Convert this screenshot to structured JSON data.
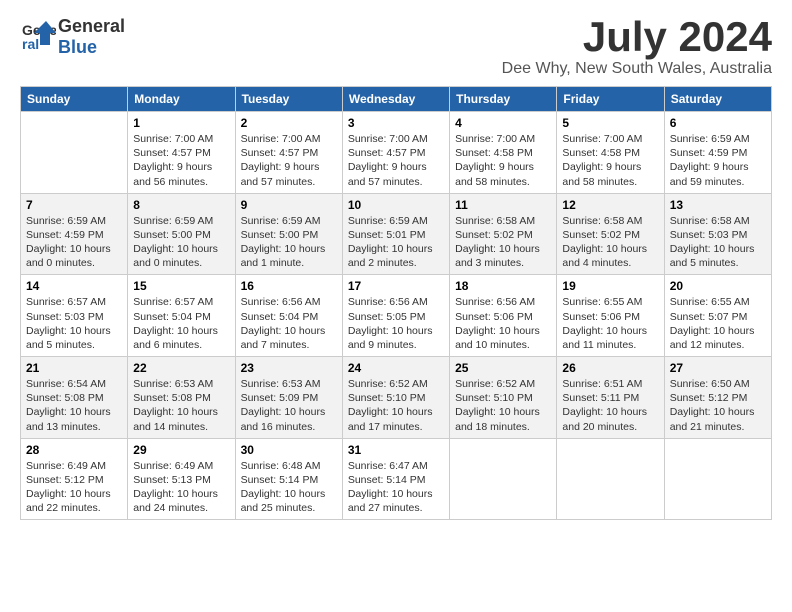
{
  "logo": {
    "general": "General",
    "blue": "Blue"
  },
  "title": "July 2024",
  "subtitle": "Dee Why, New South Wales, Australia",
  "days": [
    "Sunday",
    "Monday",
    "Tuesday",
    "Wednesday",
    "Thursday",
    "Friday",
    "Saturday"
  ],
  "weeks": [
    [
      {
        "date": "",
        "info": ""
      },
      {
        "date": "1",
        "info": "Sunrise: 7:00 AM\nSunset: 4:57 PM\nDaylight: 9 hours\nand 56 minutes."
      },
      {
        "date": "2",
        "info": "Sunrise: 7:00 AM\nSunset: 4:57 PM\nDaylight: 9 hours\nand 57 minutes."
      },
      {
        "date": "3",
        "info": "Sunrise: 7:00 AM\nSunset: 4:57 PM\nDaylight: 9 hours\nand 57 minutes."
      },
      {
        "date": "4",
        "info": "Sunrise: 7:00 AM\nSunset: 4:58 PM\nDaylight: 9 hours\nand 58 minutes."
      },
      {
        "date": "5",
        "info": "Sunrise: 7:00 AM\nSunset: 4:58 PM\nDaylight: 9 hours\nand 58 minutes."
      },
      {
        "date": "6",
        "info": "Sunrise: 6:59 AM\nSunset: 4:59 PM\nDaylight: 9 hours\nand 59 minutes."
      }
    ],
    [
      {
        "date": "7",
        "info": "Sunrise: 6:59 AM\nSunset: 4:59 PM\nDaylight: 10 hours\nand 0 minutes."
      },
      {
        "date": "8",
        "info": "Sunrise: 6:59 AM\nSunset: 5:00 PM\nDaylight: 10 hours\nand 0 minutes."
      },
      {
        "date": "9",
        "info": "Sunrise: 6:59 AM\nSunset: 5:00 PM\nDaylight: 10 hours\nand 1 minute."
      },
      {
        "date": "10",
        "info": "Sunrise: 6:59 AM\nSunset: 5:01 PM\nDaylight: 10 hours\nand 2 minutes."
      },
      {
        "date": "11",
        "info": "Sunrise: 6:58 AM\nSunset: 5:02 PM\nDaylight: 10 hours\nand 3 minutes."
      },
      {
        "date": "12",
        "info": "Sunrise: 6:58 AM\nSunset: 5:02 PM\nDaylight: 10 hours\nand 4 minutes."
      },
      {
        "date": "13",
        "info": "Sunrise: 6:58 AM\nSunset: 5:03 PM\nDaylight: 10 hours\nand 5 minutes."
      }
    ],
    [
      {
        "date": "14",
        "info": "Sunrise: 6:57 AM\nSunset: 5:03 PM\nDaylight: 10 hours\nand 5 minutes."
      },
      {
        "date": "15",
        "info": "Sunrise: 6:57 AM\nSunset: 5:04 PM\nDaylight: 10 hours\nand 6 minutes."
      },
      {
        "date": "16",
        "info": "Sunrise: 6:56 AM\nSunset: 5:04 PM\nDaylight: 10 hours\nand 7 minutes."
      },
      {
        "date": "17",
        "info": "Sunrise: 6:56 AM\nSunset: 5:05 PM\nDaylight: 10 hours\nand 9 minutes."
      },
      {
        "date": "18",
        "info": "Sunrise: 6:56 AM\nSunset: 5:06 PM\nDaylight: 10 hours\nand 10 minutes."
      },
      {
        "date": "19",
        "info": "Sunrise: 6:55 AM\nSunset: 5:06 PM\nDaylight: 10 hours\nand 11 minutes."
      },
      {
        "date": "20",
        "info": "Sunrise: 6:55 AM\nSunset: 5:07 PM\nDaylight: 10 hours\nand 12 minutes."
      }
    ],
    [
      {
        "date": "21",
        "info": "Sunrise: 6:54 AM\nSunset: 5:08 PM\nDaylight: 10 hours\nand 13 minutes."
      },
      {
        "date": "22",
        "info": "Sunrise: 6:53 AM\nSunset: 5:08 PM\nDaylight: 10 hours\nand 14 minutes."
      },
      {
        "date": "23",
        "info": "Sunrise: 6:53 AM\nSunset: 5:09 PM\nDaylight: 10 hours\nand 16 minutes."
      },
      {
        "date": "24",
        "info": "Sunrise: 6:52 AM\nSunset: 5:10 PM\nDaylight: 10 hours\nand 17 minutes."
      },
      {
        "date": "25",
        "info": "Sunrise: 6:52 AM\nSunset: 5:10 PM\nDaylight: 10 hours\nand 18 minutes."
      },
      {
        "date": "26",
        "info": "Sunrise: 6:51 AM\nSunset: 5:11 PM\nDaylight: 10 hours\nand 20 minutes."
      },
      {
        "date": "27",
        "info": "Sunrise: 6:50 AM\nSunset: 5:12 PM\nDaylight: 10 hours\nand 21 minutes."
      }
    ],
    [
      {
        "date": "28",
        "info": "Sunrise: 6:49 AM\nSunset: 5:12 PM\nDaylight: 10 hours\nand 22 minutes."
      },
      {
        "date": "29",
        "info": "Sunrise: 6:49 AM\nSunset: 5:13 PM\nDaylight: 10 hours\nand 24 minutes."
      },
      {
        "date": "30",
        "info": "Sunrise: 6:48 AM\nSunset: 5:14 PM\nDaylight: 10 hours\nand 25 minutes."
      },
      {
        "date": "31",
        "info": "Sunrise: 6:47 AM\nSunset: 5:14 PM\nDaylight: 10 hours\nand 27 minutes."
      },
      {
        "date": "",
        "info": ""
      },
      {
        "date": "",
        "info": ""
      },
      {
        "date": "",
        "info": ""
      }
    ]
  ]
}
